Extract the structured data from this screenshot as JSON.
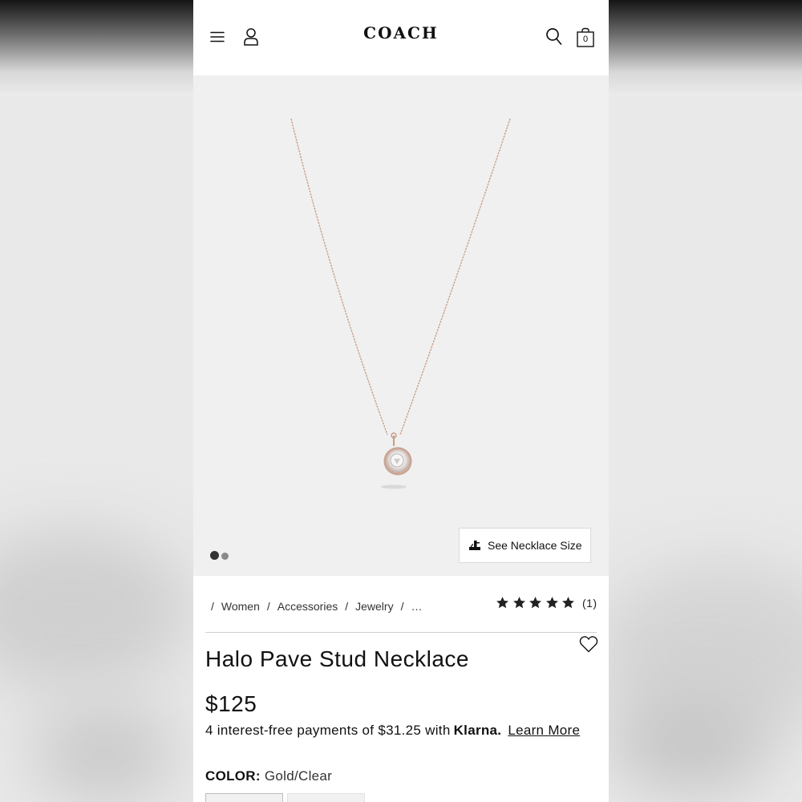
{
  "header": {
    "brand": "COACH",
    "cart_count": "0"
  },
  "gallery": {
    "image_count": 2,
    "active_index": 1,
    "size_button_label": "See Necklace Size"
  },
  "breadcrumb": {
    "items": [
      "Women",
      "Accessories",
      "Jewelry",
      "…"
    ]
  },
  "rating": {
    "stars": 5,
    "count_label": "(1)"
  },
  "product": {
    "title": "Halo Pave Stud Necklace",
    "price": "$125",
    "installments_text": "4 interest-free payments of $31.25 with",
    "klarna_brand": "Klarna.",
    "learn_more": "Learn More",
    "color_label": "COLOR:",
    "color_value": "Gold/Clear"
  },
  "colors": {
    "chain": "#c9a08a",
    "gallery_bg": "#f0f0f0",
    "text": "#111111"
  }
}
